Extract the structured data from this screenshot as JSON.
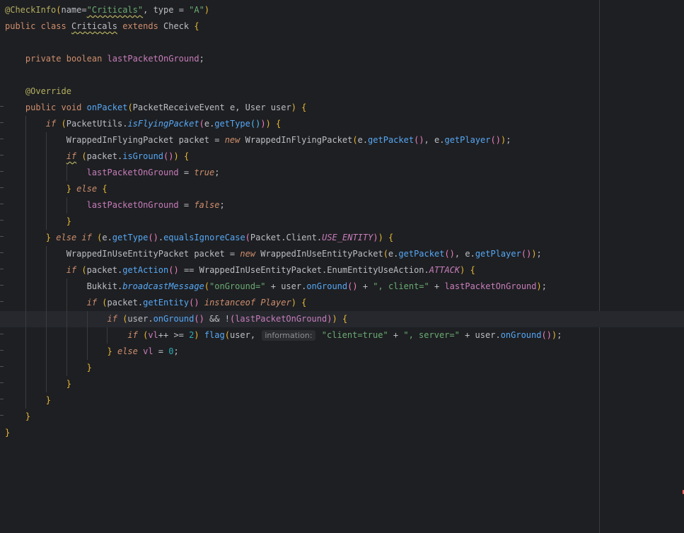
{
  "editor": {
    "language": "Java",
    "theme": "dark",
    "current_line": 20,
    "inlay_hint": "information:",
    "lines": [
      "@CheckInfo(name=\"Criticals\", type = \"A\")",
      "public class Criticals extends Check {",
      "",
      "    private boolean lastPacketOnGround;",
      "",
      "    @Override",
      "    public void onPacket(PacketReceiveEvent e, User user) {",
      "        if (PacketUtils.isFlyingPacket(e.getType())) {",
      "            WrappedInFlyingPacket packet = new WrappedInFlyingPacket(e.getPacket(), e.getPlayer());",
      "            if (packet.isGround()) {",
      "                lastPacketOnGround = true;",
      "            } else {",
      "                lastPacketOnGround = false;",
      "            }",
      "        } else if (e.getType().equalsIgnoreCase(Packet.Client.USE_ENTITY)) {",
      "            WrappedInUseEntityPacket packet = new WrappedInUseEntityPacket(e.getPacket(), e.getPlayer());",
      "            if (packet.getAction() == WrappedInUseEntityPacket.EnumEntityUseAction.ATTACK) {",
      "                Bukkit.broadcastMessage(\"onGround=\" + user.onGround() + \", client=\" + lastPacketOnGround);",
      "                if (packet.getEntity() instanceof Player) {",
      "                    if (user.onGround() && !(lastPacketOnGround)) {",
      "                        if (vl++ >= 2) flag(user, information: \"client=true\" + \", server=\" + user.onGround());",
      "                    } else vl = 0;",
      "                }",
      "            }",
      "        }",
      "    }",
      "}"
    ]
  },
  "colors": {
    "background": "#1e1f22",
    "keyword": "#cf8e6d",
    "string": "#6aab73",
    "number": "#2aacb8",
    "field": "#c77dbb",
    "method": "#56a8f5",
    "annotation": "#b3ae60",
    "text": "#bcbec4"
  }
}
